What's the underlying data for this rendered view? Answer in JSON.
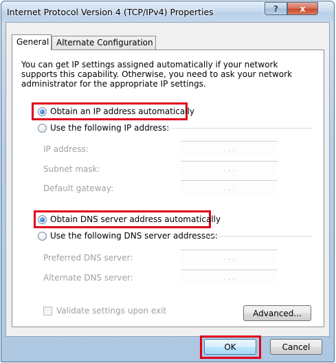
{
  "window": {
    "title": "Internet Protocol Version 4 (TCP/IPv4) Properties",
    "help_label": "?",
    "close_label": "x"
  },
  "tabs": [
    {
      "label": "General",
      "active": true
    },
    {
      "label": "Alternate Configuration",
      "active": false
    }
  ],
  "intro_text": "You can get IP settings assigned automatically if your network supports this capability. Otherwise, you need to ask your network administrator for the appropriate IP settings.",
  "ip_section": {
    "auto_label": "Obtain an IP address automatically",
    "manual_label": "Use the following IP address:",
    "selected": "auto",
    "fields": [
      {
        "label": "IP address:",
        "value": ". . ."
      },
      {
        "label": "Subnet mask:",
        "value": ". . ."
      },
      {
        "label": "Default gateway:",
        "value": ". . ."
      }
    ]
  },
  "dns_section": {
    "auto_label": "Obtain DNS server address automatically",
    "manual_label": "Use the following DNS server addresses:",
    "selected": "auto",
    "fields": [
      {
        "label": "Preferred DNS server:",
        "value": ". . ."
      },
      {
        "label": "Alternate DNS server:",
        "value": ". . ."
      }
    ]
  },
  "validate_label": "Validate settings upon exit",
  "buttons": {
    "advanced": "Advanced...",
    "ok": "OK",
    "cancel": "Cancel"
  },
  "colors": {
    "highlight": "#e0001b",
    "title_bar": "#c9dcef",
    "close_button": "#c74b2f"
  },
  "icons": {
    "radio_selected": "radio-selected-icon",
    "radio_empty": "radio-empty-icon",
    "checkbox": "checkbox-icon"
  }
}
